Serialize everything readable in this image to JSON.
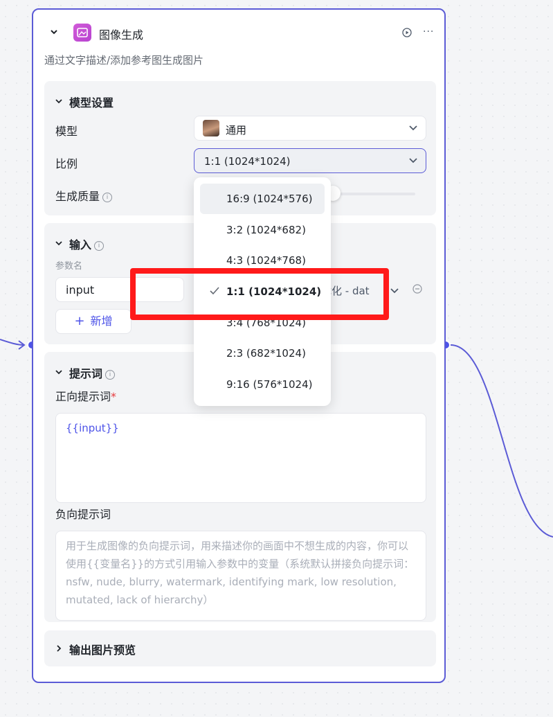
{
  "node": {
    "title": "图像生成",
    "description": "通过文字描述/添加参考图生成图片",
    "more_label": "···",
    "icon": "image-generation-icon",
    "accent_color": "#5b5bd6"
  },
  "model_settings": {
    "title": "模型设置",
    "model_label": "模型",
    "model_value": "通用",
    "ratio_label": "比例",
    "ratio_value": "1:1 (1024*1024)",
    "quality_label": "生成质量"
  },
  "input_section": {
    "title": "输入",
    "param_header": "参数名",
    "param_name": "input",
    "param_value_partial": "优化 - dat",
    "add_label": "新增"
  },
  "prompt_section": {
    "title": "提示词",
    "positive_label": "正向提示词",
    "required_mark": "*",
    "positive_value": "{{input}}",
    "negative_label": "负向提示词",
    "negative_placeholder": "用于生成图像的负向提示词，用来描述你的画面中不想生成的内容，你可以使用{{变量名}}的方式引用输入参数中的变量（系统默认拼接负向提示词：nsfw, nude, blurry, watermark, identifying mark, low resolution, mutated, lack of hierarchy）"
  },
  "output_section": {
    "title": "输出图片预览"
  },
  "ratio_dropdown": {
    "options": [
      {
        "label": "16:9 (1024*576)"
      },
      {
        "label": "3:2 (1024*682)"
      },
      {
        "label": "4:3 (1024*768)"
      },
      {
        "label": "1:1 (1024*1024)"
      },
      {
        "label": "3:4 (768*1024)"
      },
      {
        "label": "2:3 (682*1024)"
      },
      {
        "label": "9:16 (576*1024)"
      }
    ],
    "selected": "1:1 (1024*1024)"
  },
  "colors": {
    "accent": "#4d53e8",
    "highlight": "#ff1a1a"
  }
}
